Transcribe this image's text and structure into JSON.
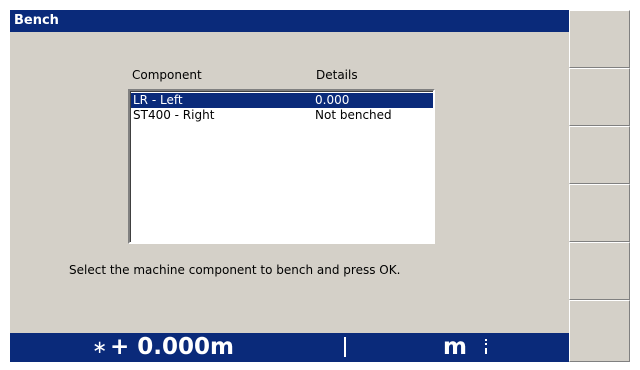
{
  "window": {
    "title": "Bench"
  },
  "list": {
    "headers": {
      "component": "Component",
      "details": "Details"
    },
    "rows": [
      {
        "component": "LR - Left",
        "details": "0.000",
        "selected": true
      },
      {
        "component": "ST400 - Right",
        "details": "Not benched",
        "selected": false
      }
    ]
  },
  "instruction": "Select the machine component to bench and press OK.",
  "status": {
    "star": "∗",
    "value": "+ 0.000m",
    "unit": "m"
  },
  "softkeys": [
    {
      "label": "",
      "icon": ""
    },
    {
      "label": "",
      "icon": ""
    },
    {
      "label": "",
      "icon": ""
    },
    {
      "label": "",
      "icon": ""
    },
    {
      "label": "",
      "icon": ""
    },
    {
      "label": "",
      "icon": ""
    }
  ],
  "colors": {
    "titlebar": "#0a2a7a",
    "selection": "#0a2a7a",
    "panel": "#d4d0c8"
  }
}
